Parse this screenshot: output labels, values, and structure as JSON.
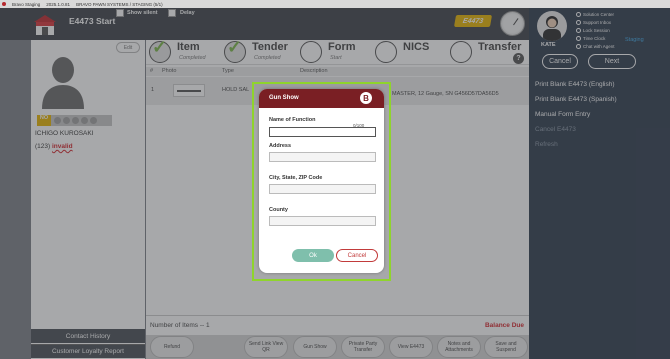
{
  "titlebar": {
    "app_name": "Bravo Staging",
    "version": "2025.1.0.81",
    "system": "BRAVO PAWN SYSTEMS / STAGING (5/1)"
  },
  "header": {
    "title": "E4473 Start",
    "show_silent_label": "Show silent",
    "delay_label": "Delay",
    "badge_text": "E4473"
  },
  "user": {
    "name": "KATE",
    "staging_label": "Staging",
    "links": [
      "Solution Center",
      "Support Inbox",
      "Lock Session",
      "Time Clock",
      "Chat with Agent"
    ],
    "cancel_label": "Cancel",
    "next_label": "Next",
    "menu": [
      {
        "label": "Print Blank E4473 (English)",
        "enabled": true
      },
      {
        "label": "Print Blank E4473 (Spanish)",
        "enabled": true
      },
      {
        "label": "Manual Form Entry",
        "enabled": true
      },
      {
        "label": "Cancel E4473",
        "enabled": false
      },
      {
        "label": "Refresh",
        "enabled": false
      }
    ]
  },
  "customer": {
    "edit_label": "Edit",
    "no_badge": "NO",
    "rating_stars": 5,
    "name": "ICHIGO KUROSAKI",
    "phone_prefix": "(123)",
    "phone_status": "invalid",
    "contact_history_label": "Contact History",
    "loyalty_report_label": "Customer Loyalty Report"
  },
  "steps": [
    {
      "label": "Item",
      "sub": "Completed",
      "done": true
    },
    {
      "label": "Tender",
      "sub": "Completed",
      "done": true
    },
    {
      "label": "Form",
      "sub": "Start",
      "done": false
    },
    {
      "label": "NICS",
      "sub": "",
      "done": false
    },
    {
      "label": "Transfer",
      "sub": "",
      "done": false
    }
  ],
  "table": {
    "headers": [
      "#",
      "Photo",
      "Type",
      "Description"
    ],
    "rows": [
      {
        "num": "1",
        "type": "HOLD SAL",
        "description": "MASTER, 12 Gauge, SN G456D57DA56D5"
      }
    ]
  },
  "footer": {
    "count_label": "Number of Items -- 1",
    "balance_label": "Balance Due"
  },
  "actions": [
    {
      "label": "Refund"
    },
    {
      "label": "Send Link View QR"
    },
    {
      "label": "Gun Show"
    },
    {
      "label": "Private Party Transfer"
    },
    {
      "label": "View E4473"
    },
    {
      "label": "Notes and Attachments"
    },
    {
      "label": "Save and Suspend"
    }
  ],
  "modal": {
    "title": "Gun Show",
    "logo": "B",
    "fields": [
      {
        "label": "Name of Function",
        "value": "",
        "counter": "0/100"
      },
      {
        "label": "Address",
        "value": ""
      },
      {
        "label": "City, State, ZIP Code",
        "value": ""
      },
      {
        "label": "County",
        "value": ""
      }
    ],
    "ok_label": "Ok",
    "cancel_label": "Cancel"
  },
  "colors": {
    "header_bg": "#3e4349",
    "user_panel_bg": "#2f3d4e",
    "modal_header": "#7a1f24",
    "highlight": "#8fd42c",
    "ok_button": "#7fbfac",
    "invalid": "#d6242a",
    "badge": "#e8b400"
  }
}
